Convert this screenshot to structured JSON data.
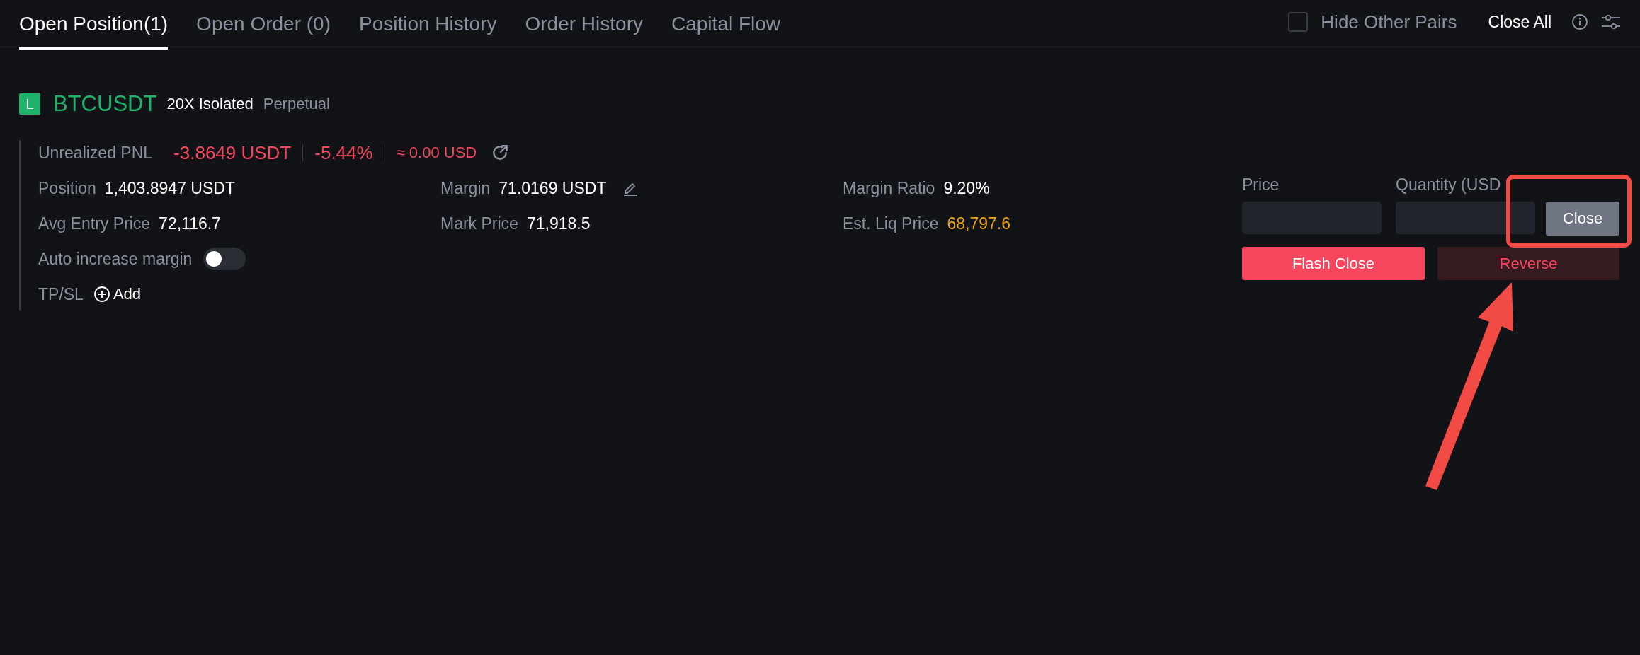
{
  "tabs": [
    {
      "label": "Open Position(1)",
      "selected": true
    },
    {
      "label": "Open Order (0)",
      "selected": false
    },
    {
      "label": "Position History",
      "selected": false
    },
    {
      "label": "Order History",
      "selected": false
    },
    {
      "label": "Capital Flow",
      "selected": false
    }
  ],
  "hide_other_pairs": {
    "label": "Hide Other Pairs",
    "checked": false
  },
  "close_all": "Close All",
  "position": {
    "side": "L",
    "symbol": "BTCUSDT",
    "leverage": "20X Isolated",
    "type": "Perpetual",
    "pnl": {
      "label": "Unrealized PNL",
      "amount": "-3.8649 USDT",
      "percent": "-5.44%",
      "usd": "≈ 0.00 USD"
    },
    "fields": [
      {
        "label": "Position",
        "value": "1,403.8947 USDT",
        "color": "#ffffff",
        "editable": false
      },
      {
        "label": "Margin",
        "value": "71.0169 USDT",
        "color": "#ffffff",
        "editable": true
      },
      {
        "label": "Margin Ratio",
        "value": "9.20%",
        "color": "#ffffff",
        "editable": false
      },
      {
        "label": "Avg Entry Price",
        "value": "72,116.7",
        "color": "#ffffff",
        "editable": false
      },
      {
        "label": "Mark Price",
        "value": "71,918.5",
        "color": "#ffffff",
        "editable": false
      },
      {
        "label": "Est. Liq Price",
        "value": "68,797.6",
        "color": "#f0a30a",
        "editable": false
      }
    ],
    "auto_margin": {
      "label": "Auto increase margin",
      "on": false
    },
    "tpsl": {
      "label": "TP/SL",
      "add": "Add"
    }
  },
  "close_form": {
    "price_label": "Price",
    "quantity_label": "Quantity (USD",
    "close": "Close",
    "flash_close": "Flash Close",
    "reverse": "Reverse"
  }
}
